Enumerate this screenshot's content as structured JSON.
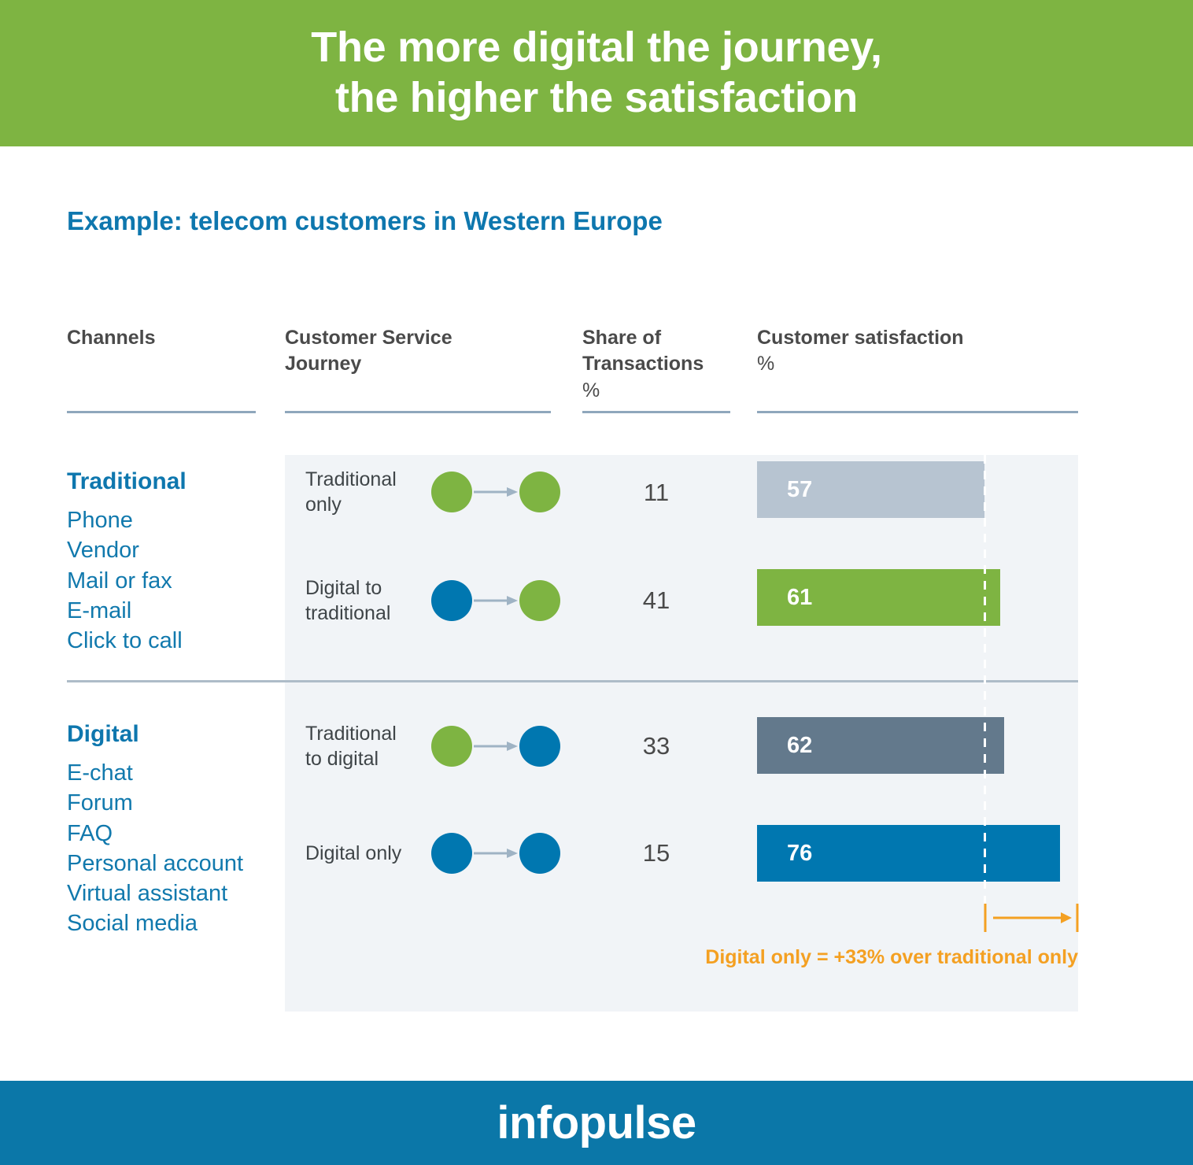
{
  "header": {
    "title": "The more digital the journey,\nthe higher the satisfaction",
    "background_color": "#7EB442"
  },
  "subtitle": "Example: telecom customers in Western Europe",
  "columns": {
    "channels": "Channels",
    "journey": "Customer Service\nJourney",
    "share": "Share of\nTransactions",
    "share_unit": "%",
    "satisfaction": "Customer satisfaction",
    "satisfaction_unit": "%"
  },
  "channel_groups": [
    {
      "title": "Traditional",
      "items": [
        "Phone",
        "Vendor",
        "Mail or fax",
        "E-mail",
        "Click to call"
      ]
    },
    {
      "title": "Digital",
      "items": [
        "E-chat",
        "Forum",
        "FAQ",
        "Personal account",
        "Virtual assistant",
        "Social media"
      ]
    }
  ],
  "rows": [
    {
      "journey": "Traditional\nonly",
      "from_node": "green",
      "to_node": "green",
      "share": "11",
      "satisfaction": "57",
      "bar_color": "#B7C4D1"
    },
    {
      "journey": "Digital to\ntraditional",
      "from_node": "blue",
      "to_node": "green",
      "share": "41",
      "satisfaction": "61",
      "bar_color": "#7EB442"
    },
    {
      "journey": "Traditional\nto digital",
      "from_node": "green",
      "to_node": "blue",
      "share": "33",
      "satisfaction": "62",
      "bar_color": "#63798C"
    },
    {
      "journey": "Digital only",
      "from_node": "blue",
      "to_node": "blue",
      "share": "15",
      "satisfaction": "76",
      "bar_color": "#0077B0"
    }
  ],
  "callout": {
    "text": "Digital only = +33% over traditional only",
    "color": "#F4A022"
  },
  "footer": {
    "logo": "infopulse",
    "background_color": "#0B77A8"
  },
  "chart_data": {
    "type": "bar",
    "title": "The more digital the journey, the higher the satisfaction",
    "subtitle": "Example: telecom customers in Western Europe",
    "orientation": "horizontal",
    "categories": [
      "Traditional only",
      "Digital to traditional",
      "Traditional to digital",
      "Digital only"
    ],
    "series": [
      {
        "name": "Customer satisfaction %",
        "values": [
          57,
          61,
          62,
          76
        ],
        "colors": [
          "#B7C4D1",
          "#7EB442",
          "#63798C",
          "#0077B0"
        ]
      },
      {
        "name": "Share of Transactions %",
        "values": [
          11,
          41,
          33,
          15
        ]
      }
    ],
    "xlabel": "",
    "ylabel": "Customer satisfaction %",
    "xlim": [
      0,
      85
    ],
    "grid": false,
    "legend": "none",
    "reference_line": {
      "value": 57,
      "style": "dashed",
      "color": "#FFFFFF"
    },
    "annotations": [
      "Digital only = +33% over traditional only"
    ]
  }
}
